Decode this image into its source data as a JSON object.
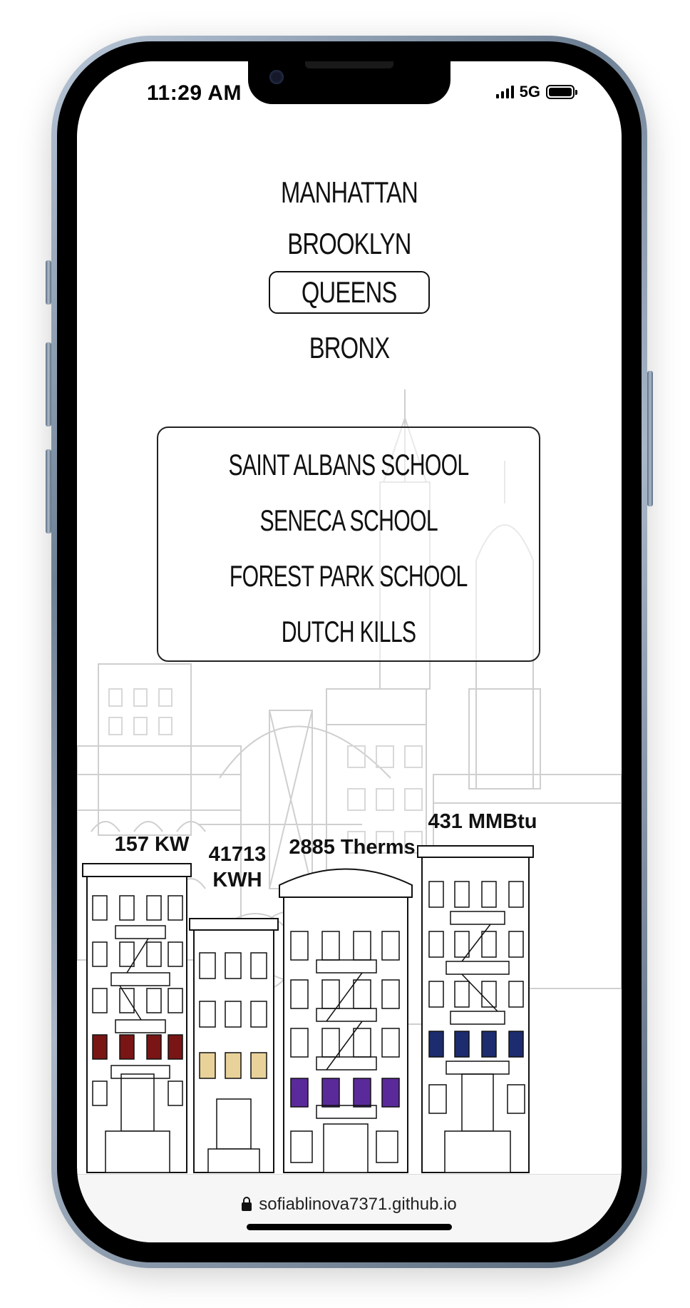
{
  "status_bar": {
    "time": "11:29 AM",
    "network": "5G"
  },
  "boroughs": [
    {
      "label": "MANHATTAN",
      "selected": false
    },
    {
      "label": "BROOKLYN",
      "selected": false
    },
    {
      "label": "QUEENS",
      "selected": true
    },
    {
      "label": "BRONX",
      "selected": false
    }
  ],
  "schools": [
    "SAINT ALBANS SCHOOL",
    "SENECA SCHOOL",
    "FOREST PARK SCHOOL",
    "DUTCH KILLS"
  ],
  "energy": {
    "electricity": "157 KW",
    "kwh_line1": "41713",
    "kwh_line2": "KWH",
    "gas": "2885 Therms",
    "steam": "431 MMBtu"
  },
  "window_colors": {
    "electricity": "#7a1515",
    "kwh": "#e9d29a",
    "gas": "#5b2a9a",
    "steam": "#1d2c6e"
  },
  "browser": {
    "url": "sofiablinova7371.github.io"
  }
}
